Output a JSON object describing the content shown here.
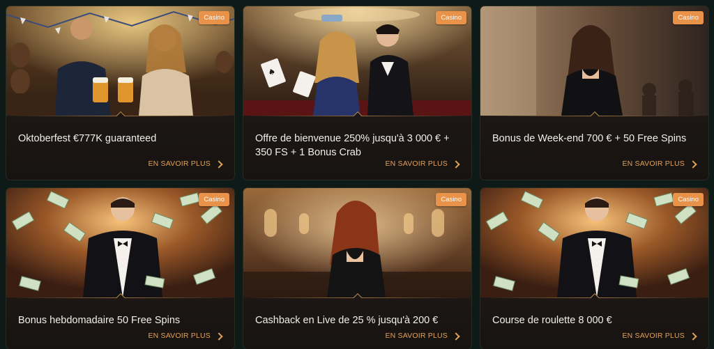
{
  "promotions": [
    {
      "title": "Oktoberfest €777K guaranteed",
      "badge": "Casino",
      "cta": "EN SAVOIR PLUS",
      "scene": "oktoberfest"
    },
    {
      "title": "Offre de bienvenue 250% jusqu'à 3 000 € + 350 FS + 1 Bonus Crab",
      "badge": "Casino",
      "cta": "EN SAVOIR PLUS",
      "scene": "couple-cards"
    },
    {
      "title": "Bonus de Week-end 700 € + 50 Free Spins",
      "badge": "Casino",
      "cta": "EN SAVOIR PLUS",
      "scene": "woman-black-dress"
    },
    {
      "title": "Bonus hebdomadaire 50 Free Spins",
      "badge": "Casino",
      "cta": "EN SAVOIR PLUS",
      "scene": "man-money-rain"
    },
    {
      "title": "Cashback en Live de 25 % jusqu'à 200 €",
      "badge": "Casino",
      "cta": "EN SAVOIR PLUS",
      "scene": "woman-casino-hall"
    },
    {
      "title": "Course de roulette 8 000 €",
      "badge": "Casino",
      "cta": "EN SAVOIR PLUS",
      "scene": "man-money-rain"
    }
  ],
  "colors": {
    "page_bg": "#0e1a17",
    "badge": "#e8924a",
    "cta": "#e3a25a",
    "title": "#f2efe9"
  },
  "icons": {
    "cta": "chevron-right-icon"
  }
}
